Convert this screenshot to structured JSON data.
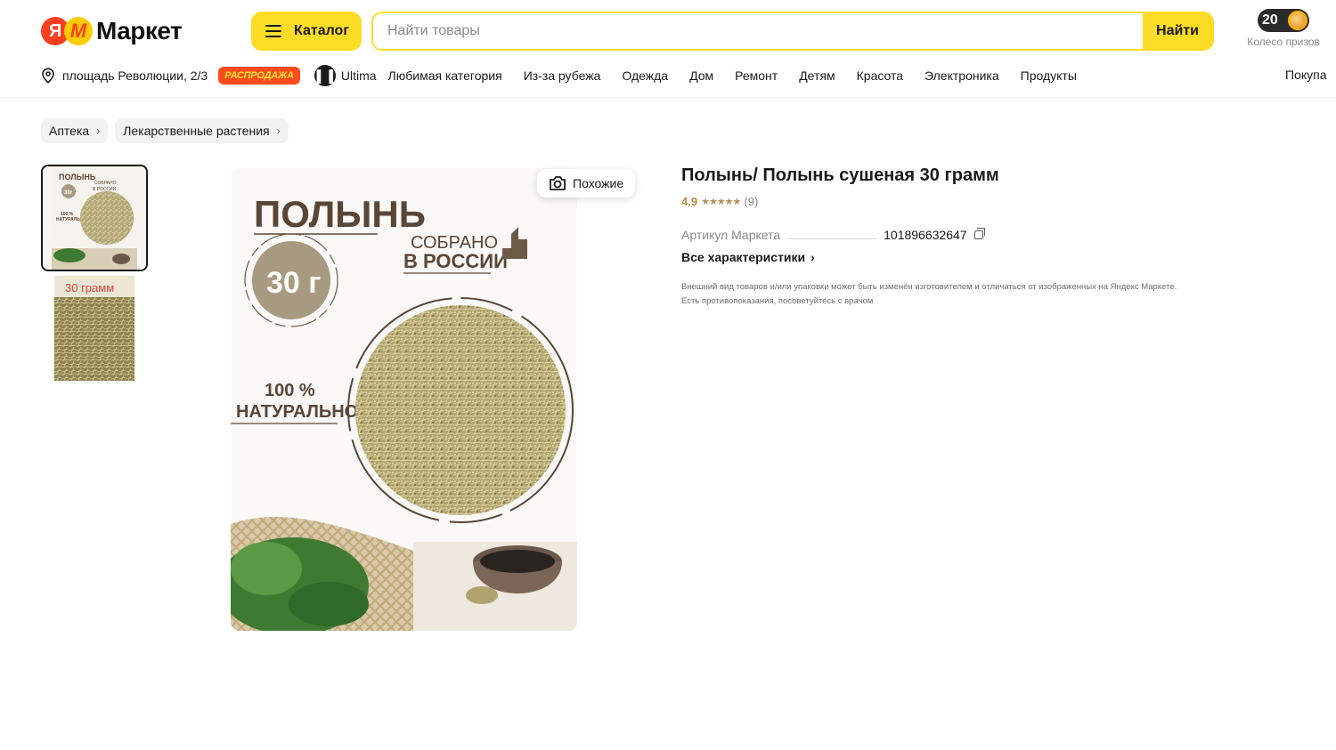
{
  "header": {
    "logo_ya": "Я",
    "logo_m": "M",
    "logo_word": "Маркет",
    "catalog_label": "Каталог",
    "search_placeholder": "Найти товары",
    "search_button": "Найти",
    "prize_count": "20",
    "prize_label": "Колесо призов"
  },
  "subnav": {
    "location": "площадь Революции, 2/3",
    "sale_badge": "РАСПРОДАЖА",
    "ultima": "Ultima",
    "links": [
      "Любимая категория",
      "Из-за рубежа",
      "Одежда",
      "Дом",
      "Ремонт",
      "Детям",
      "Красота",
      "Электроника",
      "Продукты"
    ],
    "right_link": "Покупа"
  },
  "breadcrumbs": [
    "Аптека",
    "Лекарственные растения"
  ],
  "gallery": {
    "similar_label": "Похожие",
    "main_image": {
      "title": "ПОЛЫНЬ",
      "weight": "30 г",
      "origin_line1": "СОБРАНО",
      "origin_line2": "В РОССИИ",
      "natural_line1": "100 %",
      "natural_line2": "НАТУРАЛЬНО"
    },
    "thumb1": {
      "title": "ПОЛЫНЬ",
      "weight": "30г",
      "origin_line1": "СОБРАНО",
      "origin_line2": "В РОССИИ",
      "natural_line1": "100 %",
      "natural_line2": "НАТУРАЛЬНО"
    },
    "thumb2_text": "30 грамм"
  },
  "product": {
    "title": "Полынь/ Полынь сушеная 30 грамм",
    "rating_value": "4.9",
    "rating_stars": 4.9,
    "stars_glyphs": "★★★★★",
    "reviews": "(9)",
    "sku_label": "Артикул Маркета",
    "sku_value": "101896632647",
    "all_chars": "Все характеристики",
    "disclaimer_line1": "Внешний вид товаров и/или упаковки может быть изменён изготовителем и отличаться от изображенных на Яндекс Маркете.",
    "disclaimer_line2": "Есть противопоказания, посоветуйтесь с врачом"
  },
  "colors": {
    "accent_yellow": "#ffdc25",
    "logo_red": "#fc3f1d",
    "sale_red": "#ff4a1c",
    "rating_gold": "#b58b3a"
  },
  "icons": [
    "hamburger-icon",
    "pin-icon",
    "ultima-icon",
    "camera-search-icon",
    "star-icon",
    "copy-icon",
    "chevron-right-icon",
    "coin-icon"
  ]
}
